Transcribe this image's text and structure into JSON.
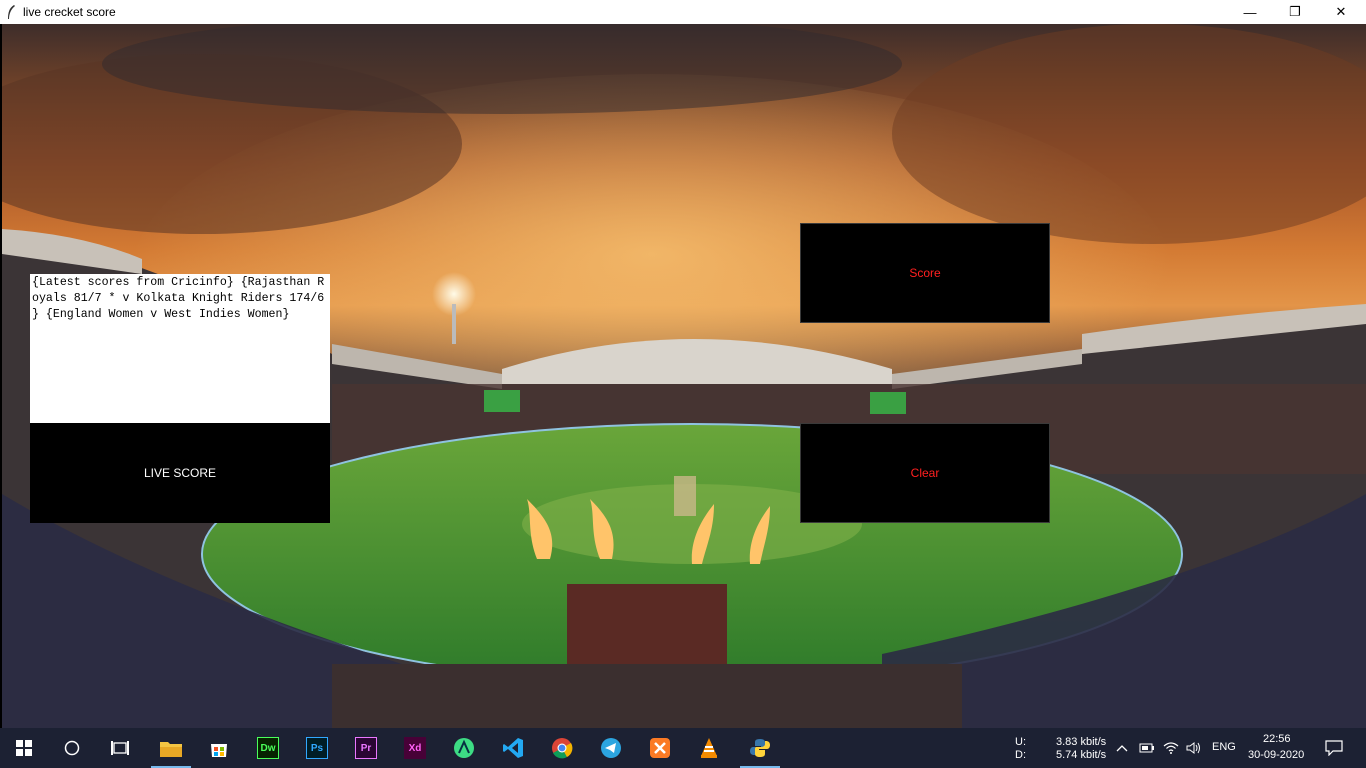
{
  "window": {
    "title": "live crecket score",
    "minimize_glyph": "—",
    "maximize_glyph": "❐",
    "close_glyph": "✕"
  },
  "app": {
    "score_text": "{Latest scores from Cricinfo} {Rajasthan Royals 81/7 * v Kolkata Knight Riders 174/6 } {England Women v West Indies Women}",
    "live_score_label": "LIVE SCORE",
    "score_label": "Score",
    "clear_label": "Clear"
  },
  "taskbar": {
    "apps": [
      "file-explorer",
      "microsoft-store",
      "dreamweaver",
      "photoshop",
      "premiere",
      "xd",
      "android-studio",
      "vscode",
      "chrome",
      "telegram",
      "xampp",
      "vlc",
      "python"
    ],
    "dw": "Dw",
    "ps": "Ps",
    "pr": "Pr",
    "xd": "Xd",
    "net_upload_label": "U:",
    "net_download_label": "D:",
    "upload_speed": "3.83 kbit/s",
    "download_speed": "5.74 kbit/s",
    "language": "ENG",
    "time": "22:56",
    "date": "30-09-2020"
  },
  "colors": {
    "button_bg": "#000000",
    "score_button_text": "#ff2020",
    "live_button_text": "#ffffff",
    "taskbar_bg": "#1c2133"
  }
}
